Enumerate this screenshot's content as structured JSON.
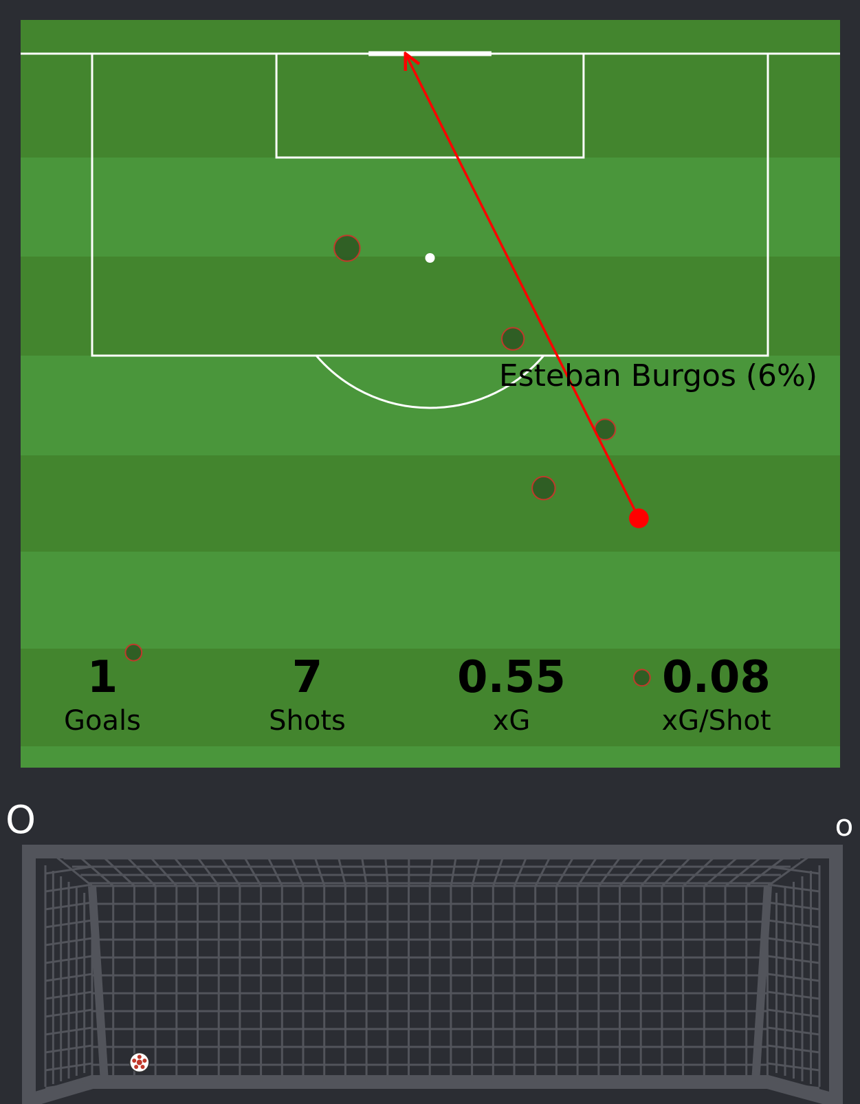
{
  "colors": {
    "background": "#2b2d33",
    "grass_light": "#4a963b",
    "grass_dark": "#43852e",
    "line": "#ffffff",
    "highlight": "#ff0000",
    "shot_fill": "#2e5a24",
    "shot_edge": "#c0392b",
    "net": "#52545b",
    "stat_text": "#000000",
    "corner_text": "#ffffff"
  },
  "chart_data": [
    {
      "type": "scatter",
      "description_free": true,
      "shots": [
        {
          "x": 34.6,
          "y": 108.4,
          "xg": 0.14
        },
        {
          "x": 45.4,
          "y": 103.0,
          "xg": 0.09
        },
        {
          "x": 51.4,
          "y": 97.6,
          "xg": 0.07
        },
        {
          "x": 47.4,
          "y": 94.1,
          "xg": 0.1
        },
        {
          "x": 53.6,
          "y": 92.3,
          "xg": 0.06,
          "highlight": true,
          "end_x": 38.4,
          "end_y": 120.0
        },
        {
          "x": 20.7,
          "y": 84.3,
          "xg": 0.03
        },
        {
          "x": 53.8,
          "y": 82.8,
          "xg": 0.03
        }
      ],
      "highlight_label": "Esteban Burgos (6%)"
    },
    {
      "type": "table",
      "stats": [
        {
          "value": "1",
          "label": "Goals"
        },
        {
          "value": "7",
          "label": "Shots"
        },
        {
          "value": "0.55",
          "label": "xG"
        },
        {
          "value": "0.08",
          "label": "xG/Shot"
        }
      ]
    },
    {
      "type": "scatter",
      "goal_mouth": {
        "ball": {
          "x": 0.07,
          "y": 0.1
        }
      },
      "corner_labels": [
        "O",
        "o"
      ]
    }
  ]
}
